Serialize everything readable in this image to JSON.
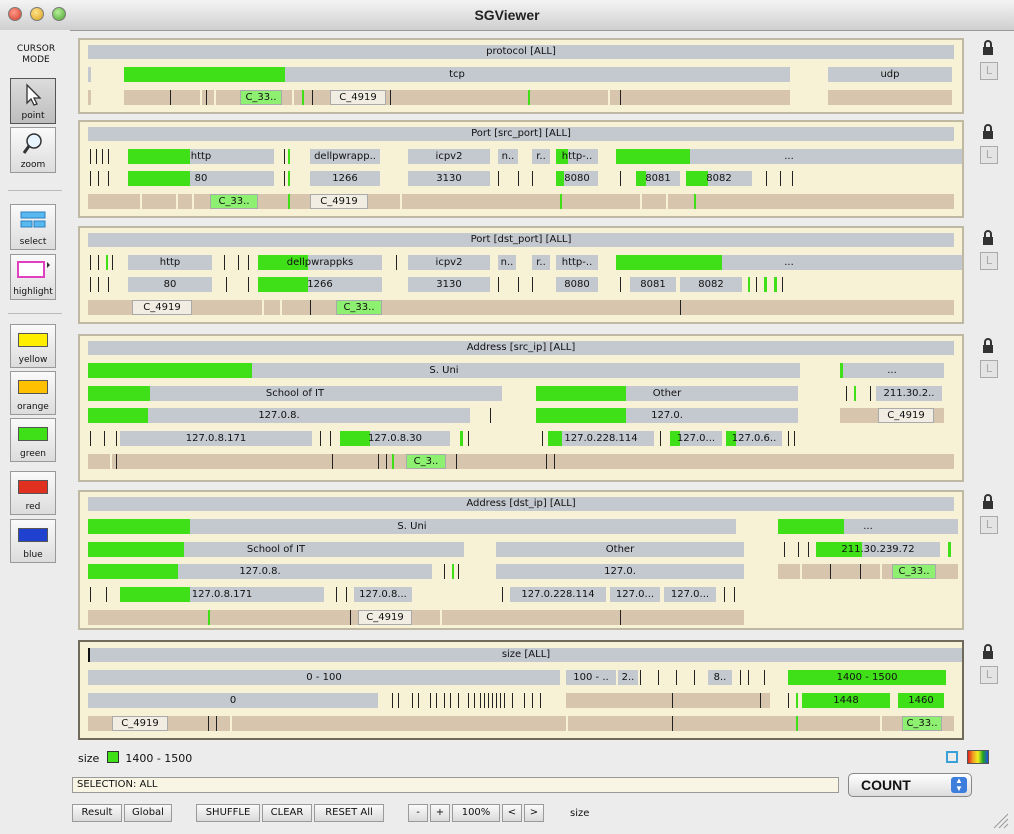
{
  "window": {
    "title": "SGViewer"
  },
  "tools": {
    "cursor_mode_label": "CURSOR\nMODE",
    "point": "point",
    "zoom": "zoom",
    "select": "select",
    "highlight": "highlight",
    "colors": [
      {
        "label": "yellow",
        "hex": "#ffee00"
      },
      {
        "label": "orange",
        "hex": "#ffc000"
      },
      {
        "label": "green",
        "hex": "#3fe018"
      },
      {
        "label": "red",
        "hex": "#e03020"
      },
      {
        "label": "blue",
        "hex": "#2040d0"
      }
    ]
  },
  "panels": {
    "protocol": {
      "title": "protocol [ALL]",
      "level1": [
        "tcp",
        "udp"
      ],
      "chips": [
        "C_33..",
        "C_4919"
      ]
    },
    "src_port": {
      "title": "Port [src_port] [ALL]",
      "level1": [
        "http",
        "dellpwrapp..",
        "icpv2",
        "n..",
        "r..",
        "http-..",
        "..."
      ],
      "level2": [
        "80",
        "1266",
        "3130",
        "8080",
        "8081",
        "8082"
      ],
      "chips": [
        "C_33..",
        "C_4919"
      ]
    },
    "dst_port": {
      "title": "Port [dst_port] [ALL]",
      "level1": [
        "http",
        "dellpwrappks",
        "icpv2",
        "n..",
        "r..",
        "http-..",
        "..."
      ],
      "level2": [
        "80",
        "1266",
        "3130",
        "8080",
        "8081",
        "8082"
      ],
      "chips": [
        "C_4919",
        "C_33.."
      ]
    },
    "src_ip": {
      "title": "Address [src_ip] [ALL]",
      "level1": [
        "S. Uni",
        "..."
      ],
      "level2": [
        "School of IT",
        "Other",
        "211.30.2.."
      ],
      "level3": [
        "127.0.8.",
        "127.0.",
        "C_4919"
      ],
      "level4": [
        "127.0.8.171",
        "127.0.8.30",
        "127.0.228.114",
        "127.0...",
        "127.0.6.."
      ],
      "chips": [
        "C_3.."
      ]
    },
    "dst_ip": {
      "title": "Address [dst_ip] [ALL]",
      "level1": [
        "S. Uni",
        "..."
      ],
      "level2": [
        "School of IT",
        "Other",
        "211.30.239.72"
      ],
      "level3": [
        "127.0.8.",
        "127.0.",
        "C_33.."
      ],
      "level4": [
        "127.0.8.171",
        "127.0.8...",
        "127.0.228.114",
        "127.0...",
        "127.0..."
      ],
      "chips": [
        "C_4919"
      ]
    },
    "size": {
      "title": "size [ALL]",
      "level1": [
        "0 - 100",
        "100 - ..",
        "2..",
        "8..",
        "1400 - 1500"
      ],
      "level2": [
        "0",
        "1448",
        "1460"
      ],
      "chips": [
        "C_4919",
        "C_33.."
      ]
    }
  },
  "legend": {
    "attr": "size",
    "color": "#3fe018",
    "value": "1400 - 1500"
  },
  "selection": {
    "label": "SELECTION:",
    "value": "ALL"
  },
  "count_select": {
    "value": "COUNT"
  },
  "bottom_buttons": {
    "result": "Result",
    "global": "Global",
    "shuffle": "SHUFFLE",
    "clear": "CLEAR",
    "reset_all": "RESET All",
    "minus": "-",
    "plus": "+",
    "zoom": "100%",
    "prev": "<",
    "next": ">"
  },
  "status_attr": "size"
}
